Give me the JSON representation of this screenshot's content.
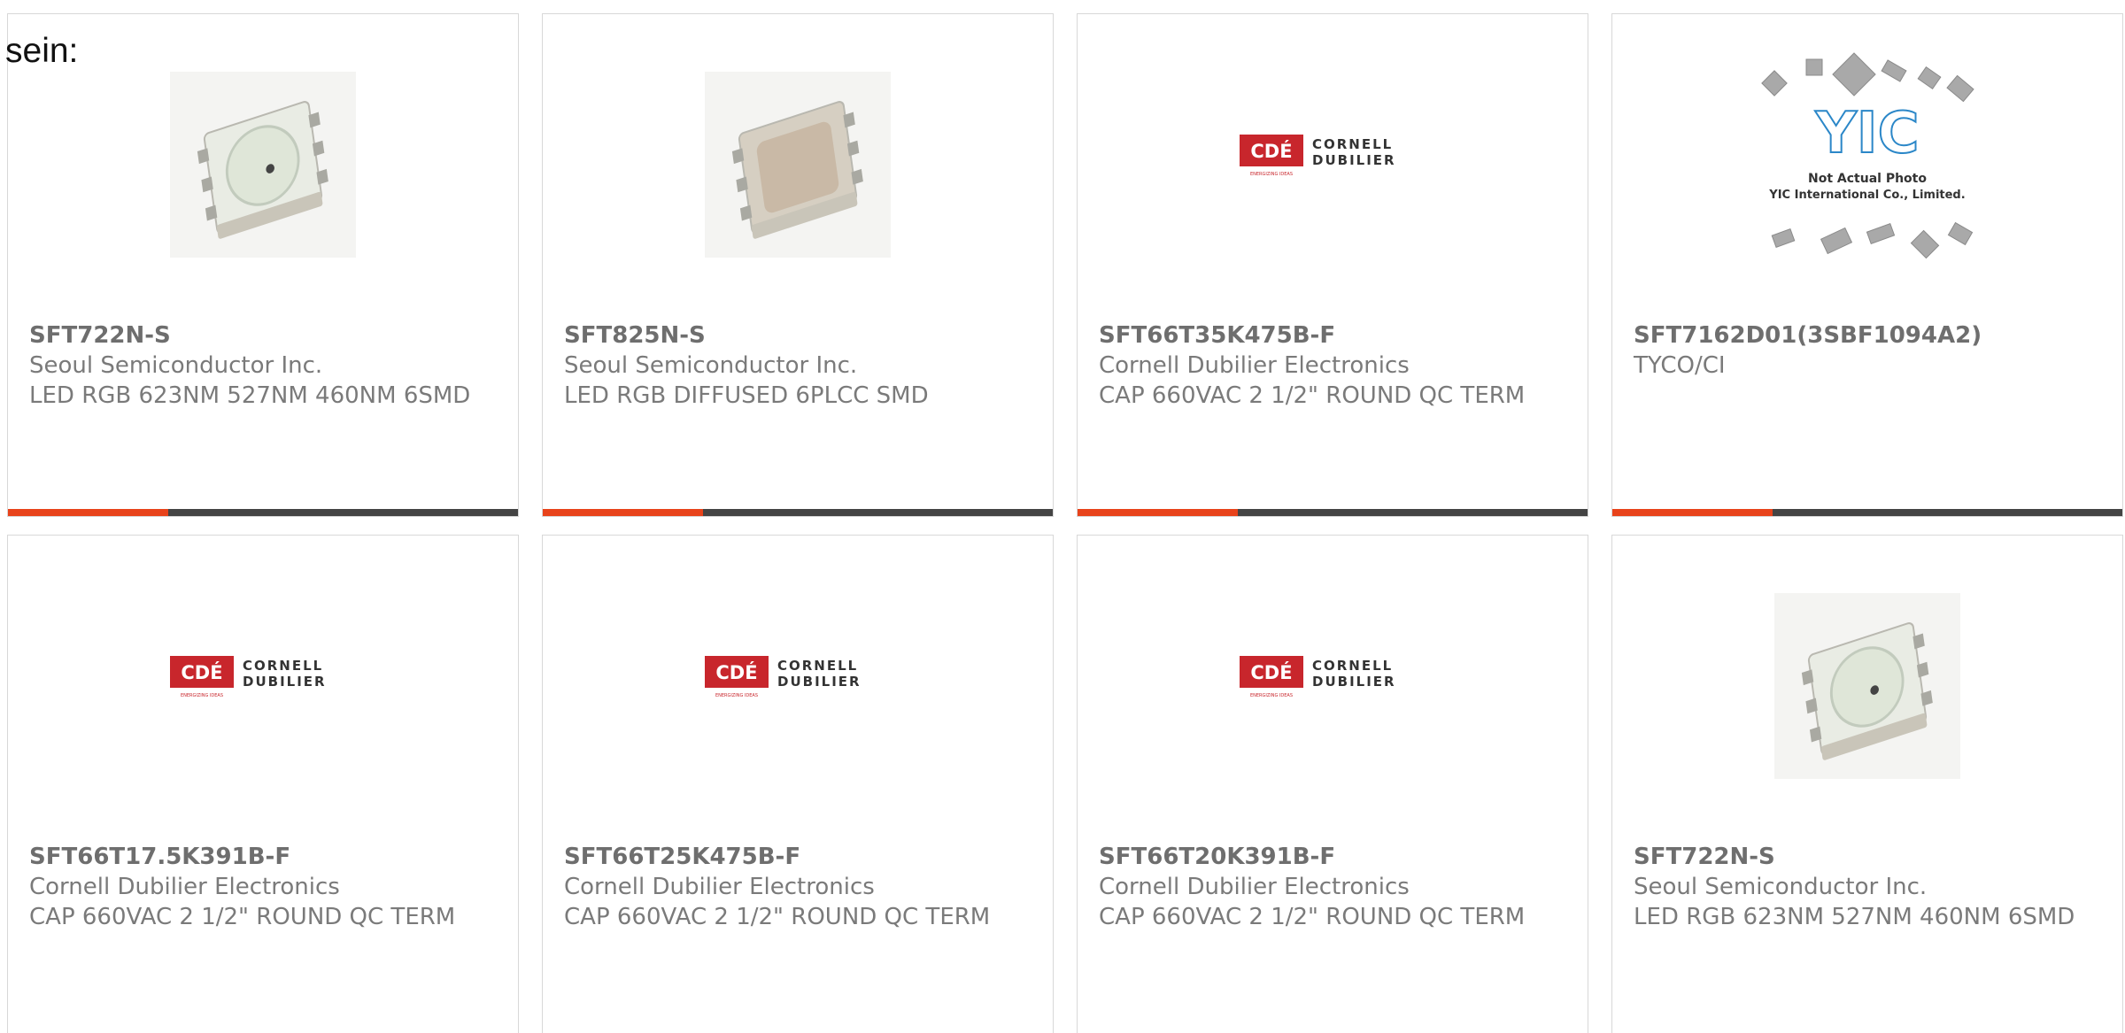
{
  "intro_text": "sein:",
  "colors": {
    "accent": "#e8431b",
    "bar": "#444444",
    "card_border": "#d8d8d8",
    "text": "#7a7a7a",
    "cde_red": "#c8262c"
  },
  "cards": [
    {
      "image": "led-rgb-smd-photo",
      "part_number": "SFT722N-S",
      "manufacturer": "Seoul Semiconductor Inc.",
      "description": "LED RGB 623NM 527NM 460NM 6SMD"
    },
    {
      "image": "led-rgb-diffused-photo",
      "part_number": "SFT825N-S",
      "manufacturer": "Seoul Semiconductor Inc.",
      "description": "LED RGB DIFFUSED 6PLCC SMD"
    },
    {
      "image": "cornell-dubilier-logo",
      "part_number": "SFT66T35K475B-F",
      "manufacturer": "Cornell Dubilier Electronics",
      "description": "CAP 660VAC 2 1/2\" ROUND QC TERM"
    },
    {
      "image": "yic-placeholder",
      "part_number": "SFT7162D01(3SBF1094A2)",
      "manufacturer": "TYCO/CI",
      "description": ""
    },
    {
      "image": "cornell-dubilier-logo",
      "part_number": "SFT66T17.5K391B-F",
      "manufacturer": "Cornell Dubilier Electronics",
      "description": "CAP 660VAC 2 1/2\" ROUND QC TERM"
    },
    {
      "image": "cornell-dubilier-logo",
      "part_number": "SFT66T25K475B-F",
      "manufacturer": "Cornell Dubilier Electronics",
      "description": "CAP 660VAC 2 1/2\" ROUND QC TERM"
    },
    {
      "image": "cornell-dubilier-logo",
      "part_number": "SFT66T20K391B-F",
      "manufacturer": "Cornell Dubilier Electronics",
      "description": "CAP 660VAC 2 1/2\" ROUND QC TERM"
    },
    {
      "image": "led-rgb-smd-photo",
      "part_number": "SFT722N-S",
      "manufacturer": "Seoul Semiconductor Inc.",
      "description": "LED RGB 623NM 527NM 460NM 6SMD"
    }
  ],
  "logos": {
    "cde_mark": "CDÉ",
    "cde_line1": "CORNELL",
    "cde_line2": "DUBILIER",
    "cde_tagline": "ENERGIZING IDEAS",
    "yic_mark": "YIC",
    "yic_note1": "Not Actual Photo",
    "yic_note2": "YIC International Co., Limited."
  }
}
